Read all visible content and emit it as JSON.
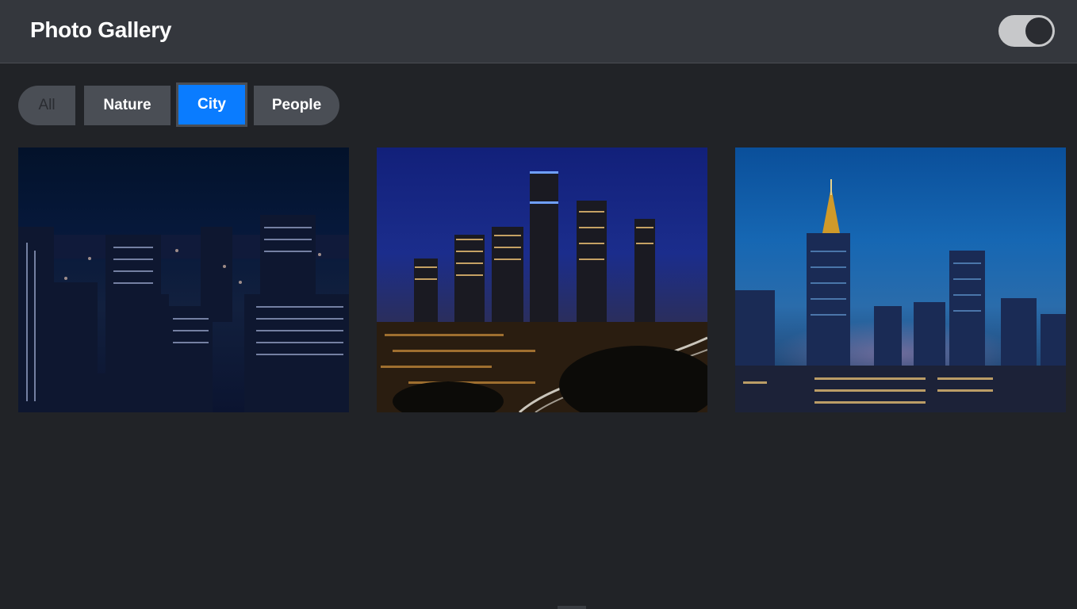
{
  "header": {
    "title": "Photo Gallery",
    "theme_toggle_state": "dark"
  },
  "filters": {
    "items": [
      {
        "label": "All",
        "active": false
      },
      {
        "label": "Nature",
        "active": false
      },
      {
        "label": "City",
        "active": true
      },
      {
        "label": "People",
        "active": false
      }
    ]
  },
  "gallery": {
    "photos": [
      {
        "subject": "night city aerial view"
      },
      {
        "subject": "night city skyline with highway"
      },
      {
        "subject": "dusk city skyscrapers"
      }
    ]
  },
  "colors": {
    "accent": "#0a7cff",
    "header_bg": "#34373d",
    "page_bg": "#212327",
    "button_bg": "#4a4e55"
  }
}
